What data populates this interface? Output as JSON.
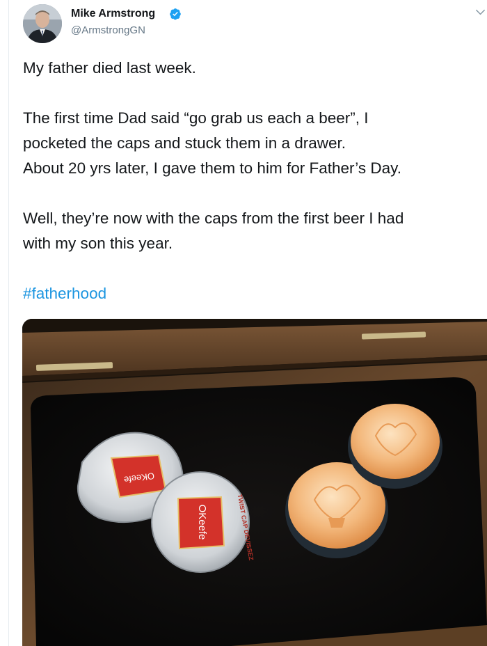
{
  "author": {
    "display_name": "Mike Armstrong",
    "handle": "@ArmstrongGN",
    "verified": true,
    "avatar_icon": "avatar-photo"
  },
  "tweet": {
    "lines_paragraph_1": [
      "My father died last week."
    ],
    "lines_paragraph_2": [
      "The first time Dad said “go grab us each a beer”, I",
      "pocketed the caps and stuck them in a drawer.",
      "About 20 yrs later, I gave them to him for Father’s Day."
    ],
    "lines_paragraph_3": [
      "Well, they’re now with the caps from the first beer I had",
      "with my son this year."
    ],
    "hashtag": "#fatherhood"
  },
  "media": {
    "bottle_cap_label_1": "OKeefe",
    "bottle_cap_label_2": "OKeefe",
    "bottle_cap_ring_text": "TWIST CAP DEVISSEZ",
    "colors": {
      "box_wood": "#5a3f26",
      "box_velvet": "#0b0a09",
      "cap_silver": "#d9dcdf",
      "cap_red": "#d3322a",
      "cap_orange": "#f0b57a"
    }
  },
  "colors": {
    "link": "#1b95e0",
    "text": "#14171a",
    "secondary_text": "#657786",
    "verified_badge": "#1da1f2"
  }
}
